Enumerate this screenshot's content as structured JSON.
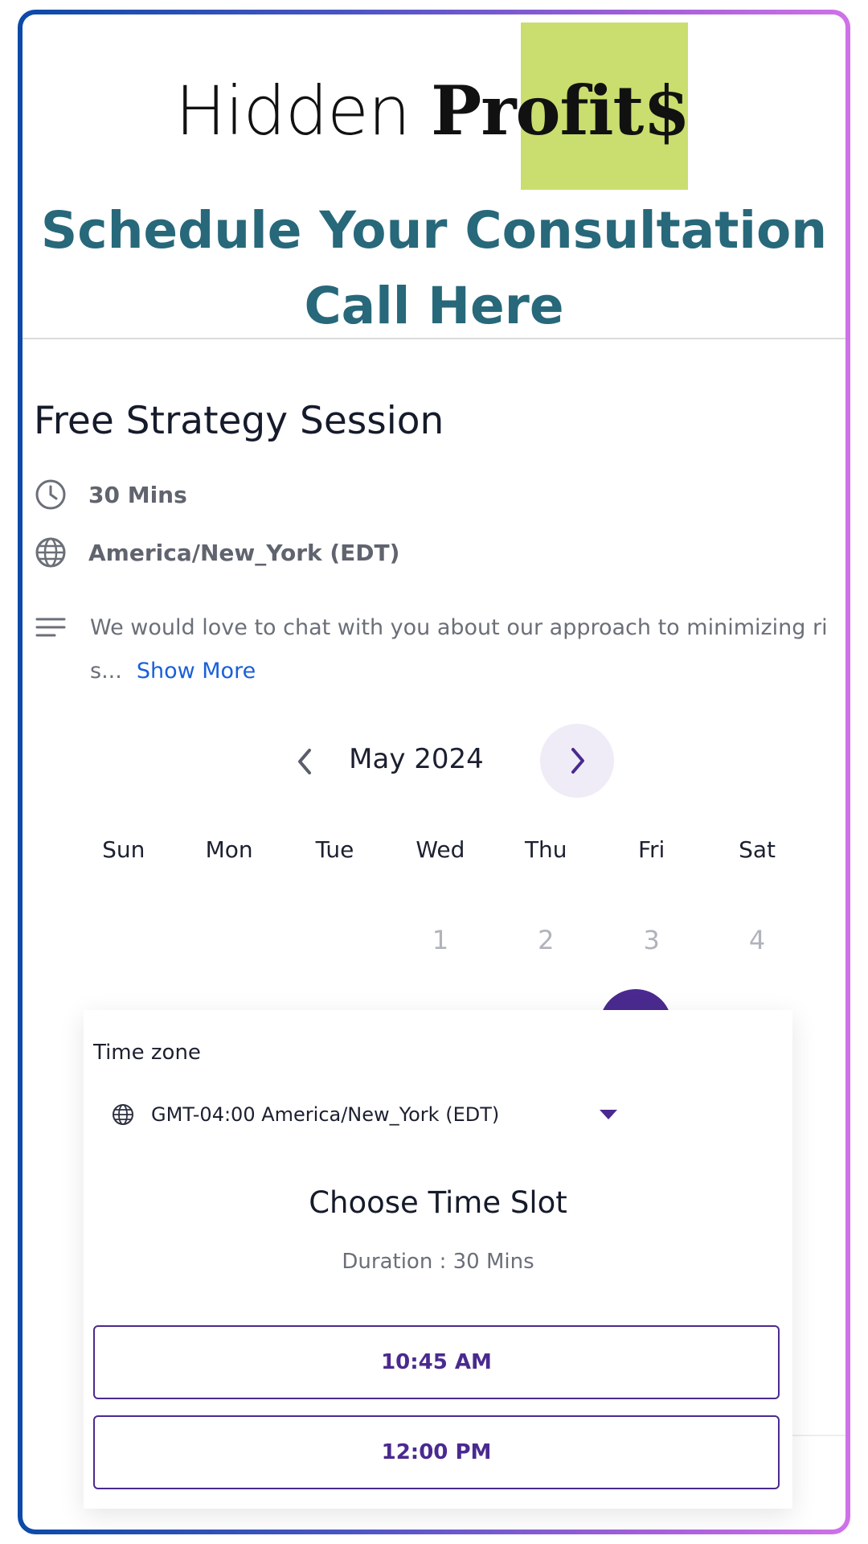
{
  "header": {
    "logo_light": "Hidden",
    "logo_bold": "Profit$",
    "headline_line1": "Schedule Your Consultation",
    "headline_line2": "Call Here"
  },
  "event": {
    "title": "Free Strategy Session",
    "duration": "30 Mins",
    "timezone": "America/New_York (EDT)",
    "description": "We would love to chat with you about our approach to minimizing ri s...",
    "show_more": "Show More"
  },
  "calendar": {
    "month": "May 2024",
    "weekdays": [
      "Sun",
      "Mon",
      "Tue",
      "Wed",
      "Thu",
      "Fri",
      "Sat"
    ],
    "first_week": [
      "",
      "",
      "",
      "1",
      "2",
      "3",
      "4"
    ]
  },
  "slots_panel": {
    "timezone_label": "Time zone",
    "timezone_value": "GMT-04:00 America/New_York (EDT)",
    "title": "Choose Time Slot",
    "duration": "Duration : 30 Mins",
    "slots": [
      "10:45 AM",
      "12:00 PM"
    ]
  },
  "colors": {
    "accent": "#4a2a8f",
    "headline": "#27687a",
    "logo_block": "#c9de6e",
    "link": "#1a5fd8"
  }
}
